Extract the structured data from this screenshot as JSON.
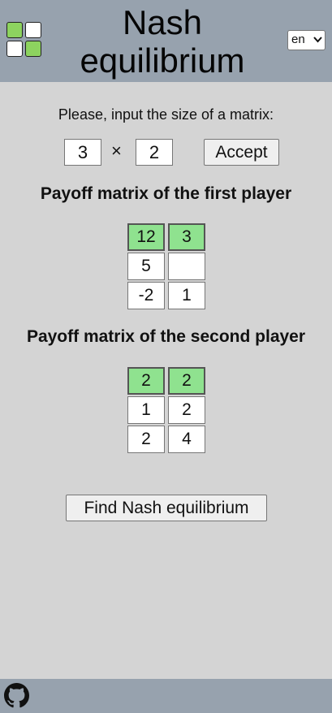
{
  "header": {
    "title_line1": "Nash",
    "title_line2": "equilibrium",
    "language": "en",
    "logo_icon": "grid-logo-icon"
  },
  "size": {
    "prompt": "Please, input the size of a matrix:",
    "rows": "3",
    "times": "×",
    "cols": "2",
    "accept_label": "Accept"
  },
  "first_player": {
    "heading": "Payoff matrix of the first player",
    "cells": [
      "12",
      "3",
      "5",
      "",
      "-2",
      "1"
    ],
    "highlighted_row": 0
  },
  "second_player": {
    "heading": "Payoff matrix of the second player",
    "cells": [
      "2",
      "2",
      "1",
      "2",
      "2",
      "4"
    ],
    "highlighted_row": 0
  },
  "find_label": "Find Nash equilibrium",
  "colors": {
    "header_bg": "#97a2ae",
    "page_bg": "#d4d4d4",
    "highlight": "#8fe28f",
    "logo_green": "#8dd35f"
  },
  "footer": {
    "icon": "github-icon"
  }
}
